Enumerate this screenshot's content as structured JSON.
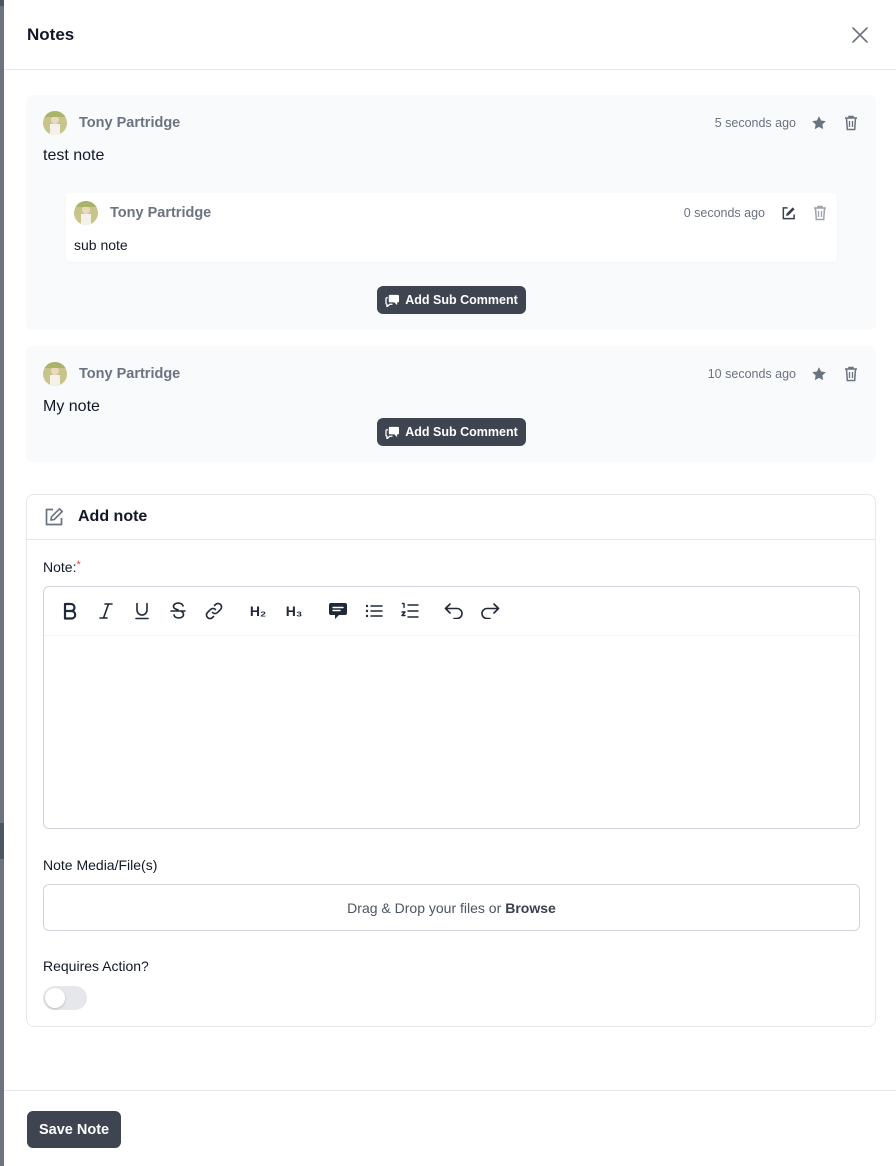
{
  "header": {
    "title": "Notes"
  },
  "notes": [
    {
      "author": "Tony Partridge",
      "time": "5 seconds ago",
      "body": "test note",
      "sub_notes": [
        {
          "author": "Tony Partridge",
          "time": "0 seconds ago",
          "body": "sub note"
        }
      ],
      "add_sub_label": "Add Sub Comment"
    },
    {
      "author": "Tony Partridge",
      "time": "10 seconds ago",
      "body": "My note",
      "add_sub_label": "Add Sub Comment"
    }
  ],
  "form": {
    "title": "Add note",
    "note_label": "Note:",
    "required_mark": "*",
    "toolbar": [
      "bold-icon",
      "italic-icon",
      "underline-icon",
      "strikethrough-icon",
      "link-icon",
      "heading-2-icon",
      "heading-3-icon",
      "comment-icon",
      "bullet-list-icon",
      "ordered-list-icon",
      "undo-icon",
      "redo-icon"
    ],
    "toolbar_h2": "H₂",
    "toolbar_h3": "H₃",
    "media_label": "Note Media/File(s)",
    "dropzone_text": "Drag & Drop your files or",
    "dropzone_link": "Browse",
    "requires_action_label": "Requires Action?",
    "requires_action_value": false
  },
  "footer": {
    "save_label": "Save Note"
  },
  "colors": {
    "accent_dark": "#3f4451",
    "card_bg": "#f9fafb",
    "required": "#ef4444"
  }
}
